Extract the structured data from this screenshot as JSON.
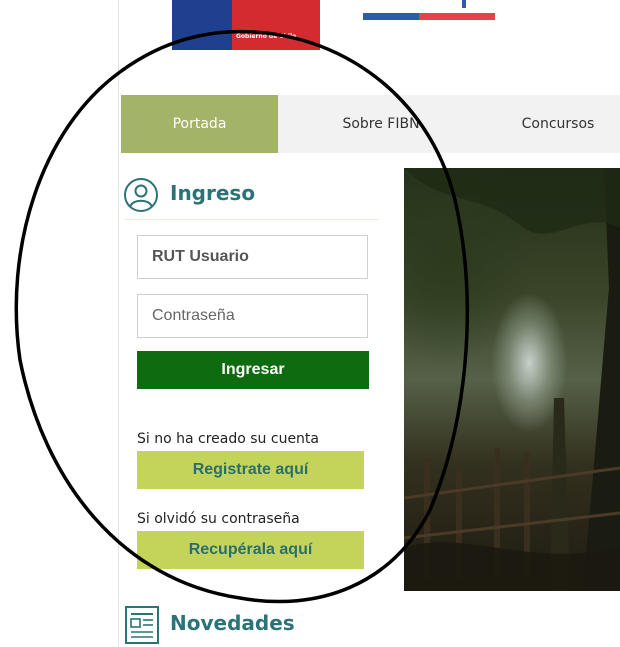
{
  "header": {
    "gov_logo_caption": "Gobierno de Chile",
    "gov_logo_colors": [
      "#1f3f8f",
      "#d32b2f"
    ],
    "brand_stripe_colors": [
      "#2f5ca8",
      "#e5434b"
    ]
  },
  "nav": {
    "active_color": "#a3b368",
    "tabs": [
      {
        "label": "Portada",
        "active": true
      },
      {
        "label": "Sobre FIBN",
        "active": false
      },
      {
        "label": "Concursos",
        "active": false
      }
    ]
  },
  "login": {
    "icon": "user-circle-icon",
    "title": "Ingreso",
    "rut_placeholder": "RUT Usuario",
    "password_placeholder": "Contraseña",
    "submit_label": "Ingresar",
    "submit_color": "#0f6b10",
    "register_prompt": "Si no ha creado su cuenta",
    "register_label": "Registrate aquí",
    "recover_prompt": "Si olvidó su contraseña",
    "recover_label": "Recupérala aquí",
    "secondary_button_color": "#c4d35a"
  },
  "news": {
    "icon": "newspaper-icon",
    "title": "Novedades"
  },
  "annotation": {
    "shape": "hand-drawn ellipse",
    "color": "#000000"
  }
}
